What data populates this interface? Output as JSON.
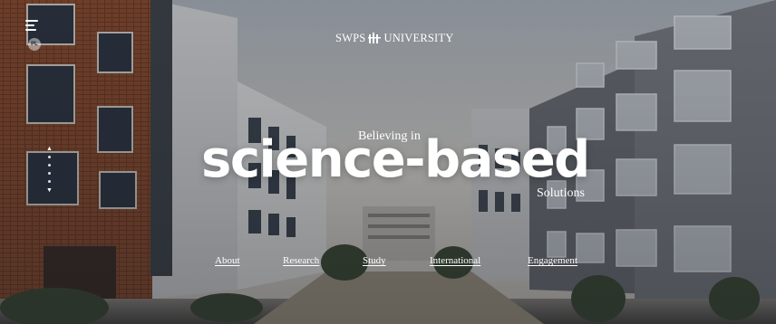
{
  "header": {
    "logo_text": "SWPS UNIVERSITY",
    "menu_icon": "hamburger-menu-icon",
    "language_label": "PL"
  },
  "hero": {
    "tagline_pre": "Believing in",
    "headline": "science-based",
    "tagline_post": "Solutions"
  },
  "nav": {
    "items": [
      {
        "label": "About"
      },
      {
        "label": "Research"
      },
      {
        "label": "Study"
      },
      {
        "label": "International"
      },
      {
        "label": "Engagement"
      }
    ]
  },
  "slider": {
    "up_icon": "chevron-up-icon",
    "down_icon": "chevron-down-icon",
    "dot_count": 4
  },
  "colors": {
    "text": "#ffffff",
    "side_panel": "#e6f2fb",
    "sky": "#c9ccd0",
    "brick": "#8a4a2e",
    "concrete": "#b9b7b2"
  }
}
